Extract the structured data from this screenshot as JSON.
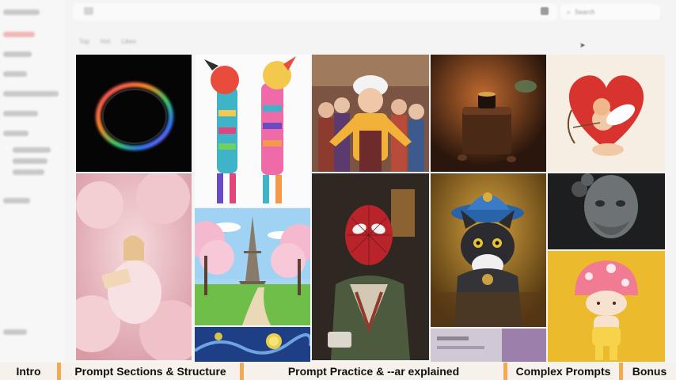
{
  "header": {
    "search_placeholder": "Search"
  },
  "subtabs": [
    "Top",
    "Hot",
    "Likes"
  ],
  "sidebar": {
    "items": [
      {
        "active": false
      },
      {
        "active": true
      },
      {
        "active": false
      },
      {
        "active": false
      },
      {
        "active": false
      },
      {
        "active": false
      },
      {
        "active": false
      },
      {
        "active": false
      },
      {
        "active": false
      },
      {
        "active": false
      },
      {
        "active": false
      },
      {
        "active": false
      }
    ]
  },
  "gallery": {
    "tiles": [
      {
        "name": "rainbow-ring-image"
      },
      {
        "name": "patterned-giraffes-image"
      },
      {
        "name": "cartoon-chef-crowd-image"
      },
      {
        "name": "chocolate-cake-image"
      },
      {
        "name": "cupid-heart-image"
      },
      {
        "name": "pink-cloud-reader-image"
      },
      {
        "name": "eiffel-tower-blossom-image"
      },
      {
        "name": "spiderman-portrait-image"
      },
      {
        "name": "cat-with-hat-image"
      },
      {
        "name": "stone-bust-image"
      },
      {
        "name": "mushroom-figure-image"
      },
      {
        "name": "starry-night-image"
      }
    ]
  },
  "chapters": [
    {
      "label": "Intro"
    },
    {
      "label": "Prompt Sections & Structure"
    },
    {
      "label": "Prompt Practice & --ar explained"
    },
    {
      "label": "Complex Prompts"
    },
    {
      "label": "Bonus"
    }
  ]
}
